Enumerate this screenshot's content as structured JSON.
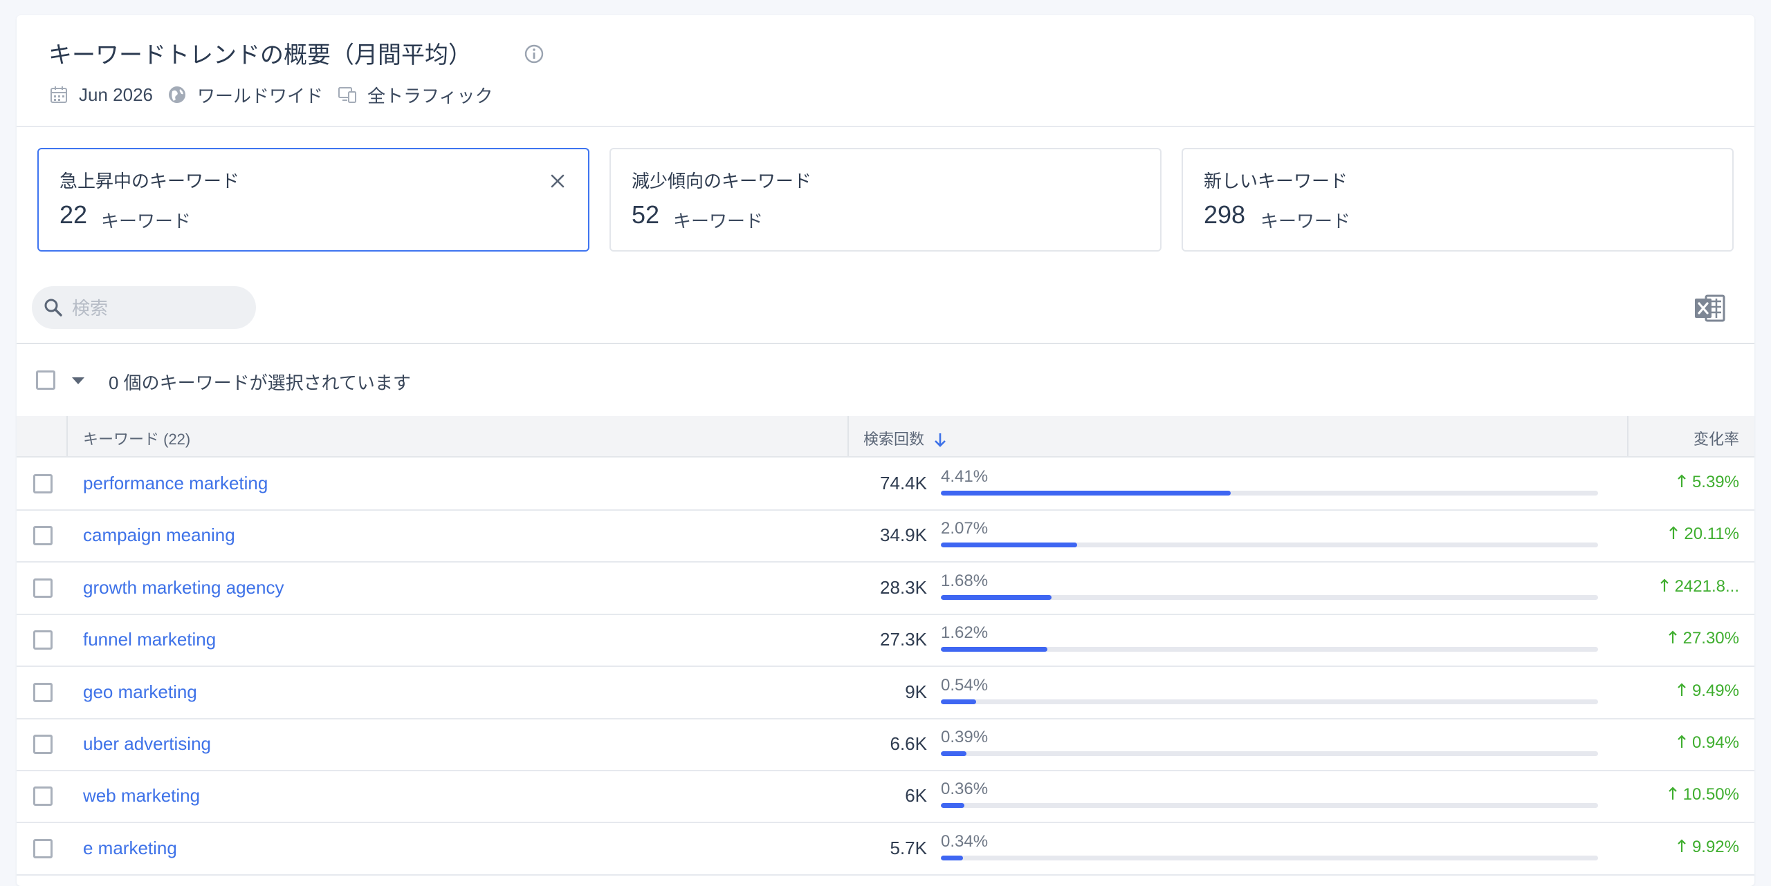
{
  "header": {
    "title": "キーワードトレンドの概要（月間平均）",
    "date": "Jun 2026",
    "region": "ワールドワイド",
    "traffic": "全トラフィック"
  },
  "summary_cards": [
    {
      "title": "急上昇中のキーワード",
      "count": "22",
      "unit": "キーワード",
      "active": true
    },
    {
      "title": "減少傾向のキーワード",
      "count": "52",
      "unit": "キーワード",
      "active": false
    },
    {
      "title": "新しいキーワード",
      "count": "298",
      "unit": "キーワード",
      "active": false
    }
  ],
  "search": {
    "placeholder": "検索",
    "value": ""
  },
  "selection": {
    "text": "0 個のキーワードが選択されています"
  },
  "table": {
    "headers": {
      "keyword": "キーワード (22)",
      "volume": "検索回数",
      "change": "変化率"
    },
    "rows": [
      {
        "keyword": "performance marketing",
        "volume": "74.4K",
        "share": "4.41%",
        "share_value": 0.0441,
        "change": "5.39%"
      },
      {
        "keyword": "campaign meaning",
        "volume": "34.9K",
        "share": "2.07%",
        "share_value": 0.0207,
        "change": "20.11%"
      },
      {
        "keyword": "growth marketing agency",
        "volume": "28.3K",
        "share": "1.68%",
        "share_value": 0.0168,
        "change": "2421.8..."
      },
      {
        "keyword": "funnel marketing",
        "volume": "27.3K",
        "share": "1.62%",
        "share_value": 0.0162,
        "change": "27.30%"
      },
      {
        "keyword": "geo marketing",
        "volume": "9K",
        "share": "0.54%",
        "share_value": 0.0054,
        "change": "9.49%"
      },
      {
        "keyword": "uber advertising",
        "volume": "6.6K",
        "share": "0.39%",
        "share_value": 0.0039,
        "change": "0.94%"
      },
      {
        "keyword": "web marketing",
        "volume": "6K",
        "share": "0.36%",
        "share_value": 0.0036,
        "change": "10.50%"
      },
      {
        "keyword": "e marketing",
        "volume": "5.7K",
        "share": "0.34%",
        "share_value": 0.0034,
        "change": "9.92%"
      }
    ]
  },
  "colors": {
    "accent": "#3e72e8",
    "bar": "#3e66f2",
    "positive": "#3fae2f",
    "active_border": "#3e74f0"
  },
  "icons": [
    "info-icon",
    "calendar-icon",
    "globe-icon",
    "devices-icon",
    "close-icon",
    "search-icon",
    "excel-export-icon",
    "chevron-down-icon",
    "sort-down-arrow-icon",
    "trend-up-arrow-icon"
  ]
}
